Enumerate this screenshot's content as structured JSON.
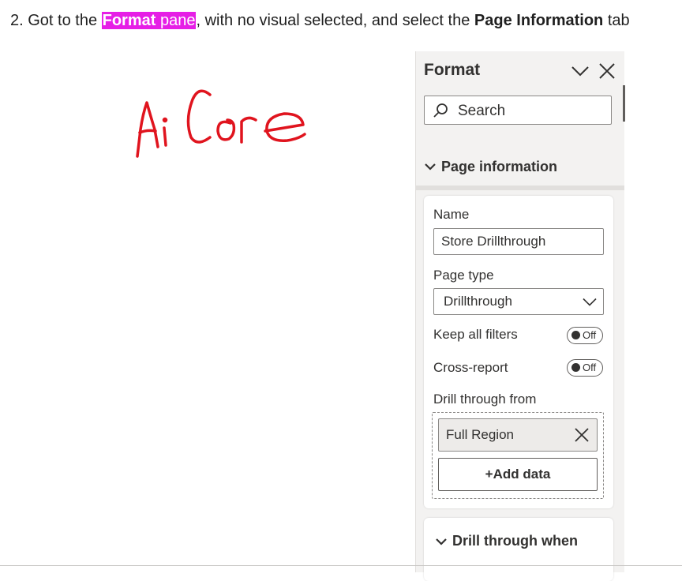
{
  "instruction": {
    "prefix": "2. Got to the ",
    "highlight_bold": "Format",
    "highlight_rest": " pane",
    "middle": ", with no visual selected, and select the ",
    "bold_tab": "Page Information",
    "suffix": " tab",
    "highlight_color": "#e61ee6"
  },
  "watermark": {
    "text": "Ai Core",
    "color": "#e0141e"
  },
  "format_pane": {
    "title": "Format",
    "search_placeholder": "Search",
    "section": "Page information",
    "fields": {
      "name_label": "Name",
      "name_value": "Store Drillthrough",
      "page_type_label": "Page type",
      "page_type_value": "Drillthrough",
      "keep_filters_label": "Keep all filters",
      "keep_filters_state": "Off",
      "cross_report_label": "Cross-report",
      "cross_report_state": "Off",
      "drill_from_label": "Drill through from",
      "drill_field": "Full Region",
      "add_data_label": "+Add data"
    },
    "section2": "Drill through when"
  }
}
